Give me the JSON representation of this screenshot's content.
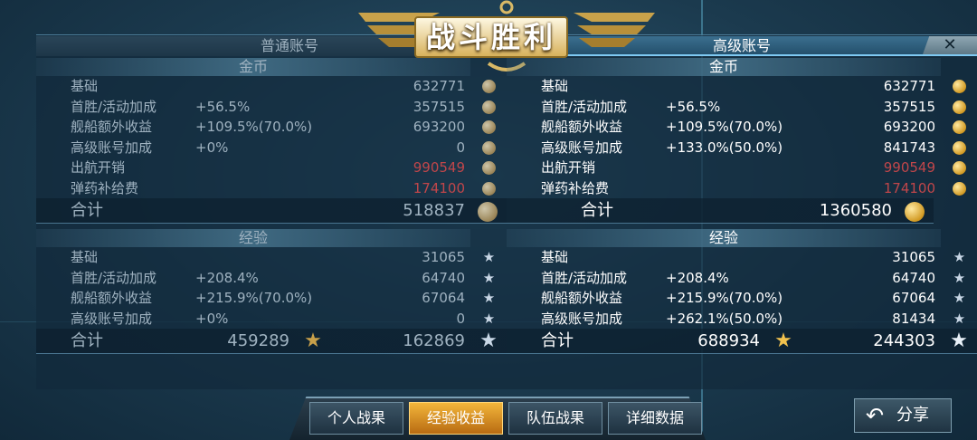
{
  "title": "战斗胜利",
  "tabs": {
    "normal": "普通账号",
    "premium": "高级账号"
  },
  "close_label": "✕",
  "normal": {
    "gold_header": "金币",
    "gold_rows": [
      {
        "label": "基础",
        "pct": "",
        "value": "632771",
        "negative": false
      },
      {
        "label": "首胜/活动加成",
        "pct": "+56.5%",
        "value": "357515",
        "negative": false
      },
      {
        "label": "舰船额外收益",
        "pct": "+109.5%(70.0%)",
        "value": "693200",
        "negative": false
      },
      {
        "label": "高级账号加成",
        "pct": "+0%",
        "value": "0",
        "negative": false
      },
      {
        "label": "出航开销",
        "pct": "",
        "value": "990549",
        "negative": true
      },
      {
        "label": "弹药补给费",
        "pct": "",
        "value": "174100",
        "negative": true
      }
    ],
    "gold_total_label": "合计",
    "gold_total": "518837",
    "xp_header": "经验",
    "xp_rows": [
      {
        "label": "基础",
        "pct": "",
        "value": "31065"
      },
      {
        "label": "首胜/活动加成",
        "pct": "+208.4%",
        "value": "64740"
      },
      {
        "label": "舰船额外收益",
        "pct": "+215.9%(70.0%)",
        "value": "67064"
      },
      {
        "label": "高级账号加成",
        "pct": "+0%",
        "value": "0"
      }
    ],
    "xp_total_label": "合计",
    "xp_total_ship": "459289",
    "xp_total_free": "162869"
  },
  "premium": {
    "gold_header": "金币",
    "gold_rows": [
      {
        "label": "基础",
        "pct": "",
        "value": "632771",
        "negative": false
      },
      {
        "label": "首胜/活动加成",
        "pct": "+56.5%",
        "value": "357515",
        "negative": false
      },
      {
        "label": "舰船额外收益",
        "pct": "+109.5%(70.0%)",
        "value": "693200",
        "negative": false
      },
      {
        "label": "高级账号加成",
        "pct": "+133.0%(50.0%)",
        "value": "841743",
        "negative": false
      },
      {
        "label": "出航开销",
        "pct": "",
        "value": "990549",
        "negative": true
      },
      {
        "label": "弹药补给费",
        "pct": "",
        "value": "174100",
        "negative": true
      }
    ],
    "gold_total_label": "合计",
    "gold_total": "1360580",
    "xp_header": "经验",
    "xp_rows": [
      {
        "label": "基础",
        "pct": "",
        "value": "31065"
      },
      {
        "label": "首胜/活动加成",
        "pct": "+208.4%",
        "value": "64740"
      },
      {
        "label": "舰船额外收益",
        "pct": "+215.9%(70.0%)",
        "value": "67064"
      },
      {
        "label": "高级账号加成",
        "pct": "+262.1%(50.0%)",
        "value": "81434"
      }
    ],
    "xp_total_label": "合计",
    "xp_total_ship": "688934",
    "xp_total_free": "244303"
  },
  "bottom_tabs": [
    "个人战果",
    "经验收益",
    "队伍战果",
    "详细数据"
  ],
  "active_tab_index": 1,
  "share_label": "分享",
  "colors": {
    "negative": "#c0464a",
    "active_tab": "#e89a28",
    "coin": "#d29a23"
  }
}
